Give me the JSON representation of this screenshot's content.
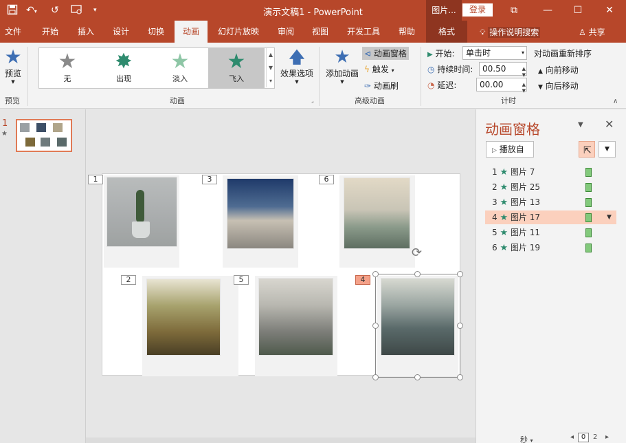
{
  "app": {
    "doc_title": "演示文稿1 - PowerPoint",
    "context_tab": "图片...",
    "login": "登录"
  },
  "icons": {
    "save": "save-icon",
    "undo": "undo-icon",
    "redo": "redo-icon",
    "present": "slideshow-icon",
    "customize": "customize-qa-icon"
  },
  "tabs": [
    "文件",
    "开始",
    "插入",
    "设计",
    "切换",
    "动画",
    "幻灯片放映",
    "审阅",
    "视图",
    "开发工具",
    "帮助",
    "格式"
  ],
  "active_tab": "动画",
  "tell_me": "操作说明搜索",
  "share": "共享",
  "ribbon": {
    "preview": {
      "label": "预览",
      "group": "预览"
    },
    "animation": {
      "group": "动画",
      "gallery": [
        "无",
        "出现",
        "淡入",
        "飞入"
      ],
      "selected": "飞入",
      "effect_options": "效果选项"
    },
    "advanced": {
      "group": "高级动画",
      "add_animation": "添加动画",
      "animation_pane": "动画窗格",
      "trigger": "触发",
      "painter": "动画刷"
    },
    "timing": {
      "group": "计时",
      "start_label": "开始:",
      "start_value": "单击时",
      "duration_label": "持续时间:",
      "duration_value": "00.50",
      "delay_label": "延迟:",
      "delay_value": "00.00",
      "reorder": "对动画重新排序",
      "move_earlier": "向前移动",
      "move_later": "向后移动"
    }
  },
  "thumbnail": {
    "number": "1",
    "mark": "★"
  },
  "slide": {
    "tags": [
      "1",
      "3",
      "6",
      "2",
      "5",
      "4"
    ],
    "selected_tag": "4"
  },
  "anim_pane": {
    "title": "动画窗格",
    "play_from": "播放自",
    "items": [
      {
        "index": "1",
        "name": "图片 7"
      },
      {
        "index": "2",
        "name": "图片 25"
      },
      {
        "index": "3",
        "name": "图片 13"
      },
      {
        "index": "4",
        "name": "图片 17"
      },
      {
        "index": "5",
        "name": "图片 11"
      },
      {
        "index": "6",
        "name": "图片 19"
      }
    ],
    "selected_index": "4",
    "seconds_label": "秒",
    "timeline_value": "0",
    "accent_color": "#b7472a"
  }
}
